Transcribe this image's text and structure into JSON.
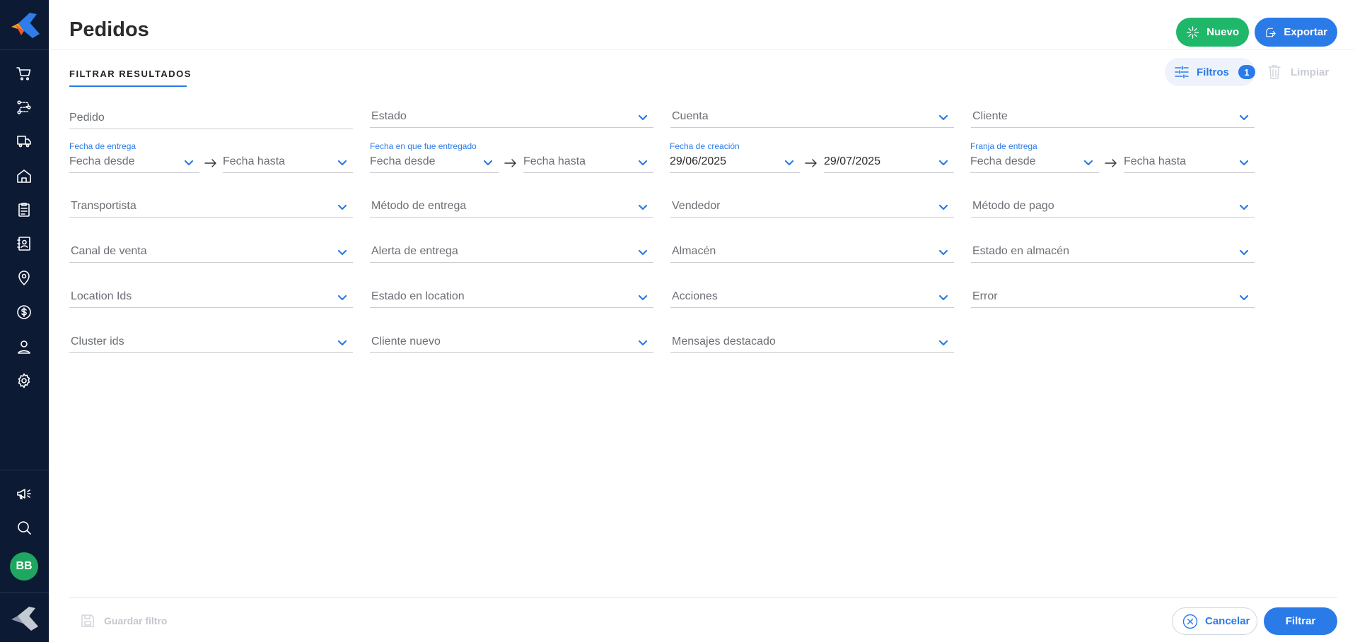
{
  "header": {
    "title": "Pedidos",
    "new_label": "Nuevo",
    "export_label": "Exportar"
  },
  "colors": {
    "sidebar": "#0c1a33",
    "accent": "#2a7be8",
    "success": "#1fb86b",
    "avatar": "#1fa661"
  },
  "sidebar": {
    "items": [
      {
        "icon": "cart-icon"
      },
      {
        "icon": "route-icon"
      },
      {
        "icon": "truck-icon"
      },
      {
        "icon": "home-icon"
      },
      {
        "icon": "clipboard-icon"
      },
      {
        "icon": "contact-book-icon"
      },
      {
        "icon": "location-pin-icon"
      },
      {
        "icon": "dollar-icon"
      },
      {
        "icon": "user-icon"
      },
      {
        "icon": "gear-icon"
      }
    ],
    "bottom": [
      {
        "icon": "megaphone-icon"
      },
      {
        "icon": "search-icon"
      }
    ],
    "avatar_initials": "BB"
  },
  "tab": {
    "label": "FILTRAR RESULTADOS"
  },
  "toolbar": {
    "filters_label": "Filtros",
    "filters_count": "1",
    "clear_label": "Limpiar"
  },
  "filters": {
    "pedido": "Pedido",
    "estado": "Estado",
    "cuenta": "Cuenta",
    "cliente": "Cliente",
    "fecha_entrega": {
      "label": "Fecha de entrega",
      "from": "Fecha desde",
      "to": "Fecha hasta"
    },
    "fecha_entregado": {
      "label": "Fecha en que fue entregado",
      "from": "Fecha desde",
      "to": "Fecha hasta"
    },
    "fecha_creacion": {
      "label": "Fecha de creación",
      "from": "29/06/2025",
      "to": "29/07/2025"
    },
    "franja_entrega": {
      "label": "Franja de entrega",
      "from": "Fecha desde",
      "to": "Fecha hasta"
    },
    "transportista": "Transportista",
    "metodo_entrega": "Método de entrega",
    "vendedor": "Vendedor",
    "metodo_pago": "Método de pago",
    "canal_venta": "Canal de venta",
    "alerta_entrega": "Alerta de entrega",
    "almacen": "Almacén",
    "estado_almacen": "Estado en almacén",
    "location_ids": "Location Ids",
    "estado_location": "Estado en location",
    "acciones": "Acciones",
    "error": "Error",
    "cluster_ids": "Cluster ids",
    "cliente_nuevo": "Cliente nuevo",
    "mensajes_destacado": "Mensajes destacado"
  },
  "footer": {
    "save_filter_label": "Guardar filtro",
    "cancel_label": "Cancelar",
    "filter_label": "Filtrar"
  }
}
